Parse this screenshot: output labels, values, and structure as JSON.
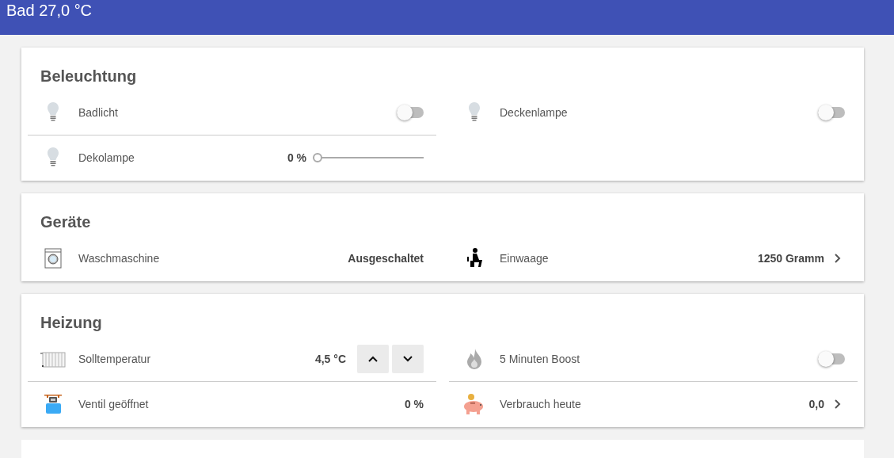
{
  "header": {
    "title": "Bad 27,0 °C"
  },
  "cards": [
    {
      "title": "Beleuchtung",
      "items": [
        {
          "kind": "switch",
          "label": "Badlicht",
          "on": false
        },
        {
          "kind": "switch",
          "label": "Deckenlampe",
          "on": false
        },
        {
          "kind": "slider",
          "label": "Dekolampe",
          "value": "0 %",
          "level": 0
        }
      ]
    },
    {
      "title": "Geräte",
      "items": [
        {
          "kind": "value",
          "label": "Waschmaschine",
          "value": "Ausgeschaltet"
        },
        {
          "kind": "link",
          "label": "Einwaage",
          "value": "1250 Gramm"
        }
      ]
    },
    {
      "title": "Heizung",
      "items": [
        {
          "kind": "stepper",
          "label": "Solltemperatur",
          "value": "4,5 °C"
        },
        {
          "kind": "switch",
          "label": "5 Minuten Boost",
          "on": false
        },
        {
          "kind": "value",
          "label": "Ventil geöffnet",
          "value": "0 %"
        },
        {
          "kind": "link",
          "label": "Verbrauch heute",
          "value": "0,0"
        }
      ]
    }
  ]
}
